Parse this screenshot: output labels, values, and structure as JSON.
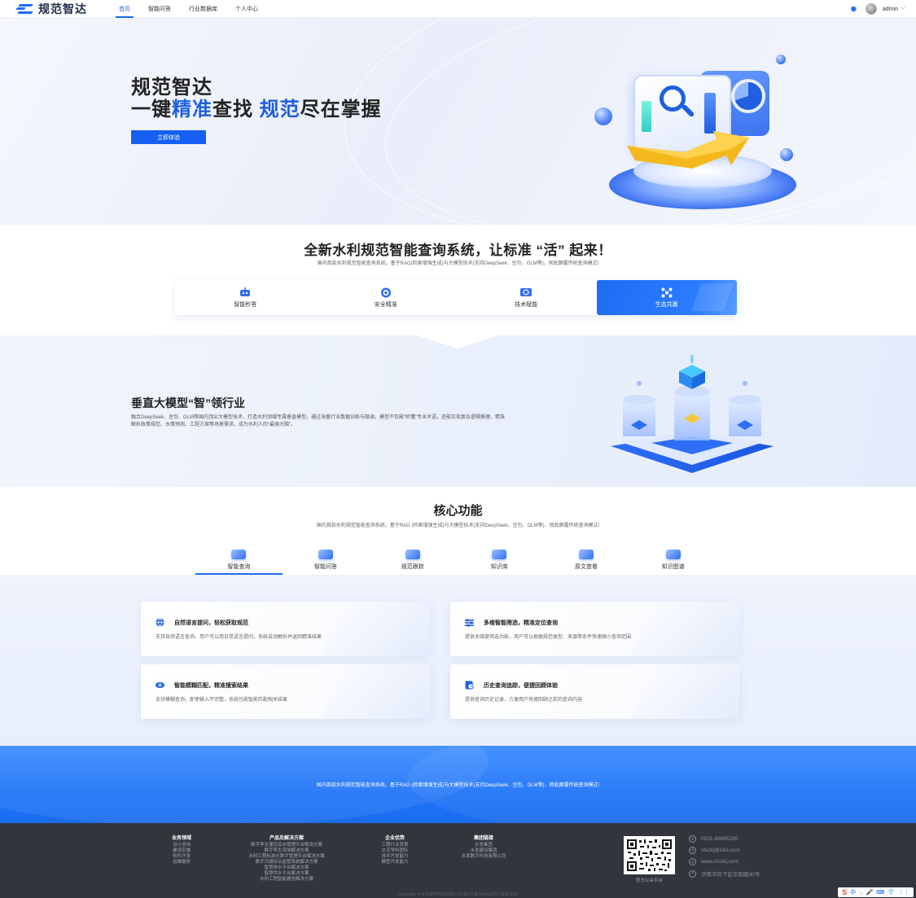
{
  "app": {
    "logo_text": "规范智达"
  },
  "nav": {
    "items": [
      "首页",
      "智能问答",
      "行业数据库",
      "个人中心"
    ],
    "user": "admin"
  },
  "hero": {
    "title": "规范智达",
    "subtitle_parts": [
      "一键",
      "精准",
      "查找 ",
      "规范",
      "尽在掌握"
    ],
    "cta": "立即体验"
  },
  "intro": {
    "title": "全新水利规范智能查询系统，让标准 “活” 起来！",
    "desc": "国内首款水利规范智能查询系统。基于RAG(检索增强生成)与大模型技术(支持DeepSeek、豆包、GLM等)，彻底颠覆传统查询模式!",
    "features": [
      {
        "label": "智能秒答",
        "icon": "robot-icon"
      },
      {
        "label": "安全精准",
        "icon": "target-icon"
      },
      {
        "label": "技术赋能",
        "icon": "tech-icon"
      },
      {
        "label": "生态共赢",
        "icon": "network-icon"
      }
    ],
    "active_feature": 3
  },
  "vertical": {
    "title": "垂直大模型“智”领行业",
    "desc": "融合DeepSeek、豆包、GLM等国内顶尖大模型技术，打造水利领域专属垂直模型。通过海量行业数据训练与微调，模型不仅能“听懂”专业术语，还能实现复杂逻辑推理，精准解析政策规范、水情预测、工程方案等场景需求，成为水利人的“最强大脑”。"
  },
  "core": {
    "title": "核心功能",
    "desc": "国内首款水利规范智能查询系统，基于RAG (检索增强生成)与大模型技术(支持DeepSeek、豆包、GLM等)，彻底颠覆传统查询模式!",
    "tabs": [
      "智能查询",
      "智能问答",
      "规范跟踪",
      "知识库",
      "原文查看",
      "知识图谱"
    ],
    "active_tab": 0,
    "cards": [
      {
        "title": "自然语言提问，轻松获取规范",
        "desc": "支持自然语言查询，用户可以用日常语言提问，系统自动解析并返回精准结果",
        "icon": "globe-icon"
      },
      {
        "title": "多维智能筛选，精准定位查询",
        "desc": "提供多维度筛选功能，用户可以根据规范类型、来源等条件快速缩小查询范围",
        "icon": "filter-icon"
      },
      {
        "title": "智能模糊匹配，精准搜索结果",
        "desc": "支持模糊查询，即使输入不完整，系统也能智能匹配相关结果",
        "icon": "eye-icon"
      },
      {
        "title": "历史查询追踪，便捷回顾体验",
        "desc": "提供查询历史记录，方便用户快速回顾之前的查询内容",
        "icon": "history-icon"
      }
    ]
  },
  "banner": {
    "text": "国内首款水利规范智能查询系统，基于RAG (检索增强生成)与大模型技术(支持DeepSeek、豆包、GLM等)，彻底颠覆传统查询模式!"
  },
  "footer": {
    "columns": [
      {
        "heading": "业务领域",
        "items": [
          "设计咨询",
          "建设实施",
          "软件开发",
          "运维服务"
        ]
      },
      {
        "heading": "产品及解决方案",
        "items": [
          "数字孪生灌区综合管理平台解决方案",
          "数字孪生流域解决方案",
          "水利工程标准化数字管理平台解决方案",
          "数字河湖综合监管系统解决方案",
          "智慧排水平台解决方案",
          "智慧供水平台解决方案",
          "水利工程智能建造解决方案"
        ]
      },
      {
        "heading": "企业优势",
        "items": [
          "工程行业背景",
          "交叉学科团队",
          "技术开发能力",
          "模型开发能力"
        ]
      },
      {
        "heading": "集团链接",
        "items": [
          "水发集团",
          "水发建设集团",
          "水发数字科技有限公司"
        ]
      }
    ],
    "qr_label": "官方公众平台",
    "contacts": [
      {
        "icon": "phone-icon",
        "text": "0531-86895265"
      },
      {
        "icon": "mail-icon",
        "text": "sfszkj@163.com"
      },
      {
        "icon": "web-icon",
        "text": "www.sfszkj.com"
      },
      {
        "icon": "location-icon",
        "text": "济南市历下区华阳路30号"
      }
    ],
    "copyright": "Copyright © 水发数字科技有限公司 鲁ICP备2024000号 | 技术支持"
  },
  "ime": {
    "items": [
      "中",
      "·,",
      "🎤",
      "⌨",
      "👕",
      "⋮⋮"
    ]
  }
}
